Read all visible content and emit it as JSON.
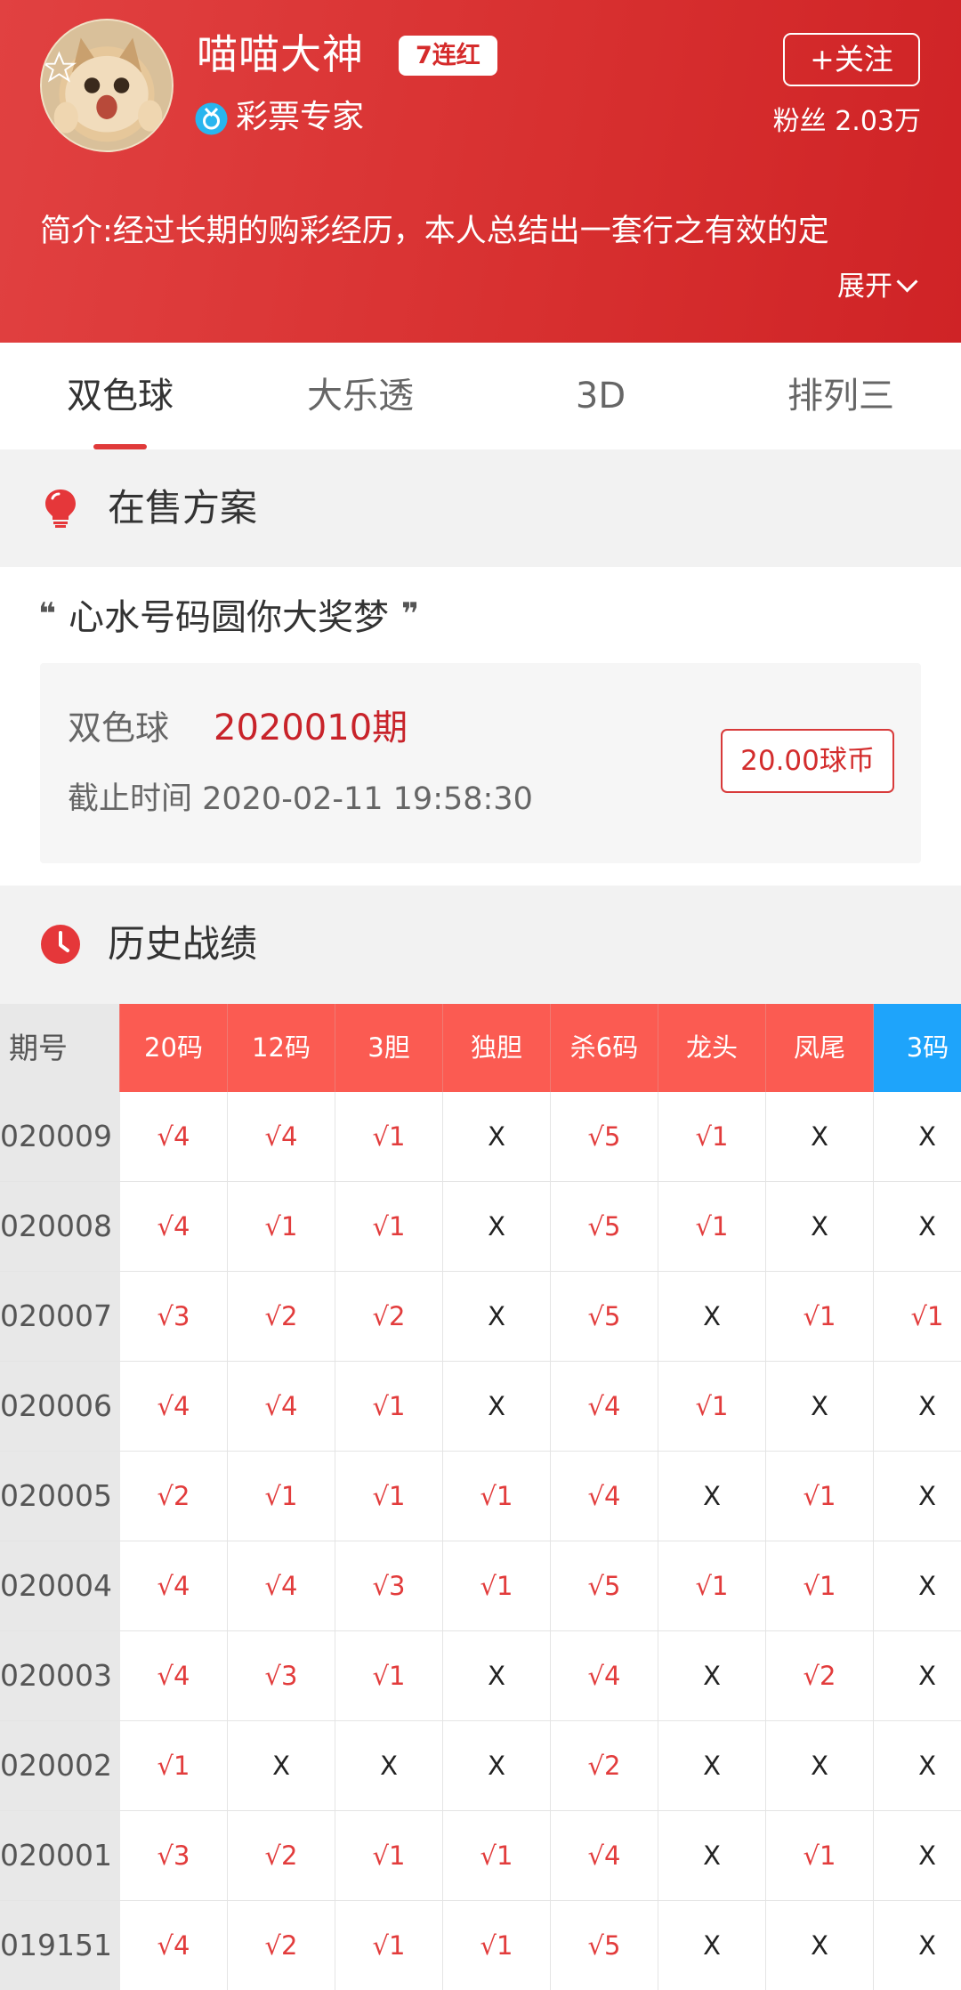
{
  "profile": {
    "name": "喵喵大神",
    "streak_badge": "7连红",
    "title": "彩票专家",
    "follow_label": "+关注",
    "fans_label": "粉丝 2.03万",
    "intro": "简介:经过长期的购彩经历，本人总结出一套行之有效的定",
    "expand_label": "展开"
  },
  "tabs": [
    {
      "label": "双色球",
      "active": true
    },
    {
      "label": "大乐透",
      "active": false
    },
    {
      "label": "3D",
      "active": false
    },
    {
      "label": "排列三",
      "active": false
    }
  ],
  "on_sale": {
    "title": "在售方案",
    "slogan": "心水号码圆你大奖梦",
    "open_quote": "❝",
    "close_quote": "❞",
    "lottery": "双色球",
    "issue": "2020010期",
    "deadline": "截止时间 2020-02-11 19:58:30",
    "price": "20.00球币"
  },
  "history": {
    "title": "历史战绩",
    "headers": [
      "期号",
      "20码",
      "12码",
      "3胆",
      "独胆",
      "杀6码",
      "龙头",
      "凤尾",
      "3码"
    ],
    "rows": [
      [
        "020009",
        "√4",
        "√4",
        "√1",
        "X",
        "√5",
        "√1",
        "X",
        "X"
      ],
      [
        "020008",
        "√4",
        "√1",
        "√1",
        "X",
        "√5",
        "√1",
        "X",
        "X"
      ],
      [
        "020007",
        "√3",
        "√2",
        "√2",
        "X",
        "√5",
        "X",
        "√1",
        "√1"
      ],
      [
        "020006",
        "√4",
        "√4",
        "√1",
        "X",
        "√4",
        "√1",
        "X",
        "X"
      ],
      [
        "020005",
        "√2",
        "√1",
        "√1",
        "√1",
        "√4",
        "X",
        "√1",
        "X"
      ],
      [
        "020004",
        "√4",
        "√4",
        "√3",
        "√1",
        "√5",
        "√1",
        "√1",
        "X"
      ],
      [
        "020003",
        "√4",
        "√3",
        "√1",
        "X",
        "√4",
        "X",
        "√2",
        "X"
      ],
      [
        "020002",
        "√1",
        "X",
        "X",
        "X",
        "√2",
        "X",
        "X",
        "X"
      ],
      [
        "020001",
        "√3",
        "√2",
        "√1",
        "√1",
        "√4",
        "X",
        "√1",
        "X"
      ],
      [
        "019151",
        "√4",
        "√2",
        "√1",
        "√1",
        "√5",
        "X",
        "X",
        "X"
      ]
    ]
  },
  "colors": {
    "brand_red": "#d72f2f",
    "header_red": "#fb5b52",
    "header_blue": "#1ea4fb",
    "hit_red": "#e23c3c"
  },
  "icons": {
    "badge": "medal-icon",
    "on_sale": "lightbulb-icon",
    "history": "clock-icon",
    "expand": "chevron-down-icon"
  }
}
